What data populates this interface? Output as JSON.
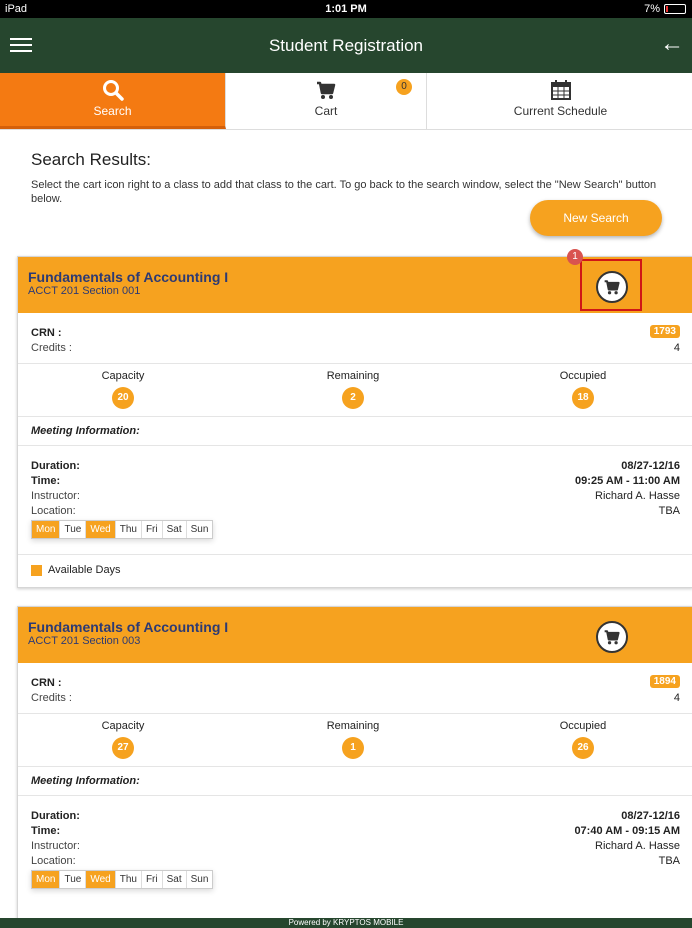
{
  "status_bar": {
    "device": "iPad",
    "time": "1:01 PM",
    "battery": "7%"
  },
  "header": {
    "title": "Student Registration"
  },
  "tabs": [
    {
      "label": "Search",
      "icon": "search-icon",
      "active": true
    },
    {
      "label": "Cart",
      "icon": "cart-icon",
      "badge": "0"
    },
    {
      "label": "Current Schedule",
      "icon": "calendar-icon"
    }
  ],
  "results": {
    "heading": "Search Results:",
    "instructions": "Select the cart icon right to a class to add that class to the cart. To go back to the search window, select the \"New Search\" button below.",
    "new_search_label": "New Search"
  },
  "highlight_badge": "1",
  "labels": {
    "crn": "CRN :",
    "credits": "Credits :",
    "capacity": "Capacity",
    "remaining": "Remaining",
    "occupied": "Occupied",
    "meeting_info": "Meeting Information:",
    "duration": "Duration:",
    "time": "Time:",
    "instructor": "Instructor:",
    "location": "Location:",
    "available_days": "Available Days"
  },
  "days": [
    "Mon",
    "Tue",
    "Wed",
    "Thu",
    "Fri",
    "Sat",
    "Sun"
  ],
  "courses": [
    {
      "title": "Fundamentals of Accounting I",
      "subtitle": "ACCT 201 Section 001",
      "crn": "1793",
      "credits": "4",
      "capacity": "20",
      "remaining": "2",
      "occupied": "18",
      "duration": "08/27-12/16",
      "time": "09:25 AM - 11:00 AM",
      "instructor": "Richard A. Hasse",
      "location": "TBA",
      "active_days": [
        "Mon",
        "Wed"
      ]
    },
    {
      "title": "Fundamentals of Accounting I",
      "subtitle": "ACCT 201 Section 003",
      "crn": "1894",
      "credits": "4",
      "capacity": "27",
      "remaining": "1",
      "occupied": "26",
      "duration": "08/27-12/16",
      "time": "07:40 AM - 09:15 AM",
      "instructor": "Richard A. Hasse",
      "location": "TBA",
      "active_days": [
        "Mon",
        "Wed"
      ]
    }
  ],
  "footer": {
    "text": "Powered by KRYPTOS MOBILE"
  },
  "colors": {
    "header": "#26462e",
    "accent": "#f47a12",
    "orange": "#f6a21f",
    "title_text": "#2d3a73",
    "highlight": "#d01616"
  }
}
